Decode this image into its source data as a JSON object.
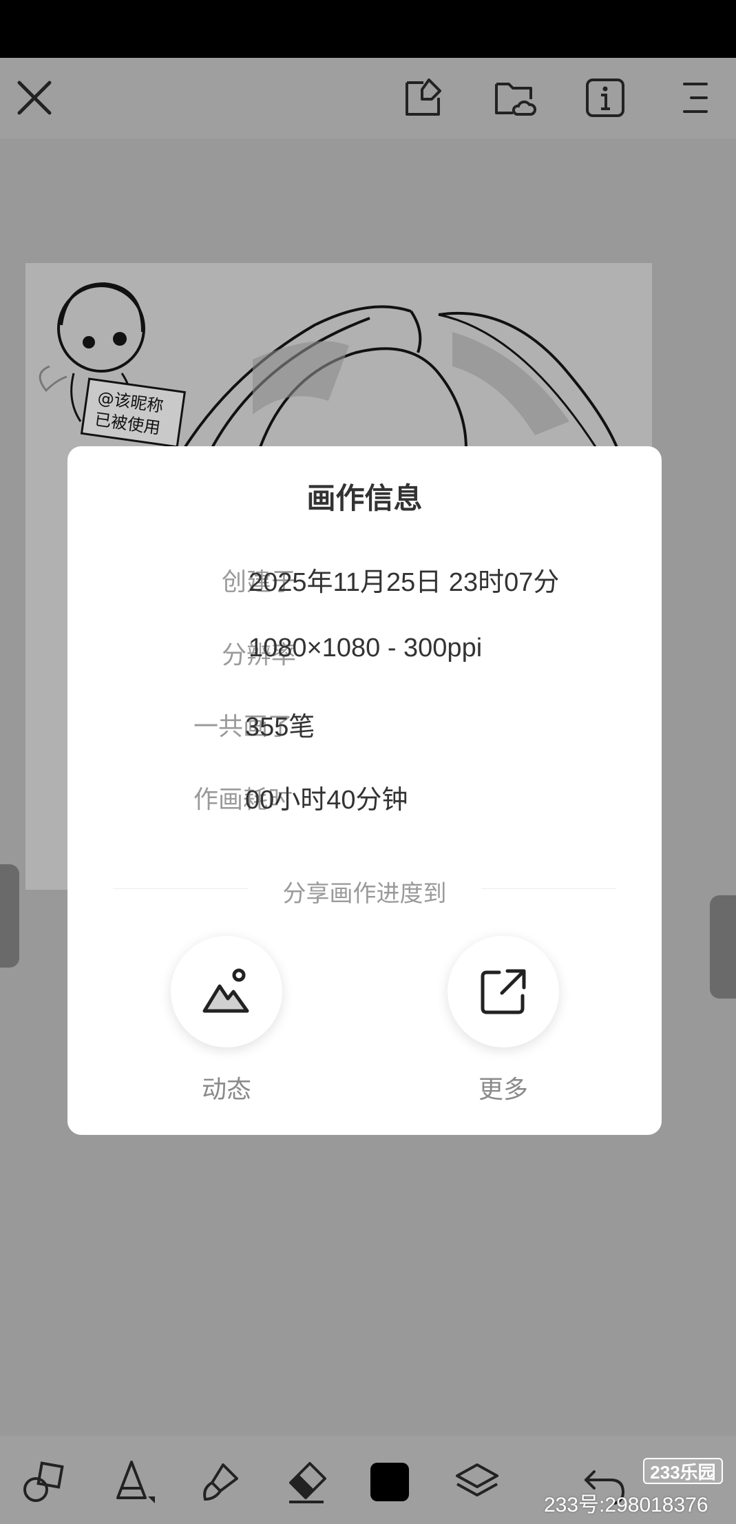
{
  "topbar": {
    "icons": [
      "close-icon",
      "document-edit-icon",
      "cloud-folder-icon",
      "info-icon",
      "menu-icon"
    ]
  },
  "dialog": {
    "title": "画作信息",
    "rows": [
      {
        "label": "创建于",
        "value": "2025年11月25日 23时07分"
      },
      {
        "label": "分辨率",
        "value": "1080×1080 - 300ppi"
      },
      {
        "label": "一共画了",
        "value": "355笔"
      },
      {
        "label": "作画耗时",
        "value": "00小时40分钟"
      }
    ],
    "share_heading": "分享画作进度到",
    "share_options": [
      {
        "label": "动态",
        "icon": "mountain-image-icon"
      },
      {
        "label": "更多",
        "icon": "external-share-icon"
      }
    ]
  },
  "artwork": {
    "sign_text": [
      "@该昵称",
      "已被使用"
    ]
  },
  "toolbar": {
    "tools": [
      "shapes-icon",
      "fill-bucket-icon",
      "brush-icon",
      "eraser-icon",
      "color-swatch",
      "layers-icon",
      "undo-icon"
    ],
    "current_color": "#000000"
  },
  "watermark": {
    "badge": "233乐园",
    "id_text": "233号:298018376"
  }
}
